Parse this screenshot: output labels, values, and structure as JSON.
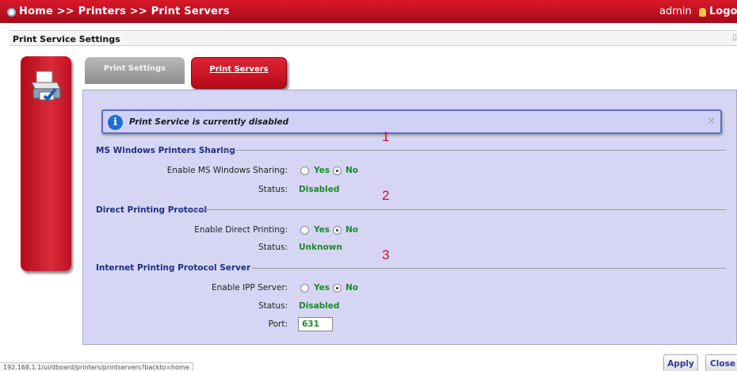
{
  "topbar": {
    "breadcrumb": "Home >> Printers >> Print Servers",
    "user": "admin",
    "logout": "Logou"
  },
  "subheader": {
    "title": "Print Service Settings"
  },
  "tabs": [
    {
      "label": "Print Settings",
      "active": false
    },
    {
      "label": "Print Servers",
      "active": true
    }
  ],
  "info": {
    "message": "Print Service is currently disabled",
    "close": "✕"
  },
  "sections": [
    {
      "title": "MS Windows Printers Sharing",
      "enable_label": "Enable MS Windows Sharing:",
      "yes": "Yes",
      "no": "No",
      "selected": "No",
      "status_label": "Status:",
      "status": "Disabled"
    },
    {
      "title": "Direct Printing Protocol",
      "enable_label": "Enable Direct Printing:",
      "yes": "Yes",
      "no": "No",
      "selected": "No",
      "status_label": "Status:",
      "status": "Unknown"
    },
    {
      "title": "Internet Printing Protocol Server",
      "enable_label": "Enable IPP Server:",
      "yes": "Yes",
      "no": "No",
      "selected": "No",
      "status_label": "Status:",
      "status": "Disabled",
      "port_label": "Port:",
      "port": "631"
    }
  ],
  "markers": [
    "1",
    "2",
    "3"
  ],
  "buttons": {
    "apply": "Apply",
    "close": "Close"
  },
  "statusbar": "192.168.1.1/ui/dboard/printers/printservers?backto=home",
  "colors": {
    "header_red": "#c8102e",
    "panel": "#d6d6f4",
    "status_green": "#1a8a2a",
    "section_blue": "#1d2f86"
  }
}
